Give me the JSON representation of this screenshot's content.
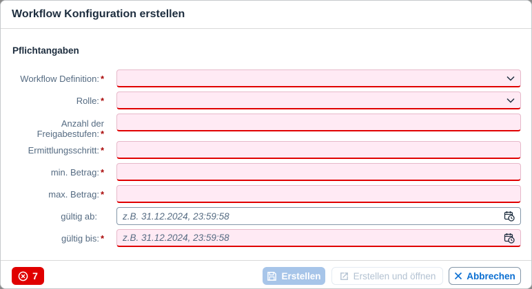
{
  "dialog": {
    "title": "Workflow Konfiguration erstellen"
  },
  "section": {
    "title": "Pflichtangaben"
  },
  "fields": {
    "workflow_definition": {
      "label": "Workflow Definition:",
      "required_mark": "*"
    },
    "rolle": {
      "label": "Rolle:",
      "required_mark": "*"
    },
    "anzahl": {
      "label_line1": "Anzahl der",
      "label_line2": "Freigabestufen:",
      "required_mark": "*"
    },
    "ermittlungsschritt": {
      "label": "Ermittlungsschritt:",
      "required_mark": "*"
    },
    "min_betrag": {
      "label": "min. Betrag:",
      "required_mark": "*"
    },
    "max_betrag": {
      "label": "max. Betrag:",
      "required_mark": "*"
    },
    "gueltig_ab": {
      "label": "gültig ab:",
      "placeholder": "z.B. 31.12.2024, 23:59:58"
    },
    "gueltig_bis": {
      "label": "gültig bis:",
      "required_mark": "*",
      "placeholder": "z.B. 31.12.2024, 23:59:58"
    }
  },
  "footer": {
    "error_count": "7",
    "create_label": "Erstellen",
    "create_open_label": "Erstellen und öffnen",
    "cancel_label": "Abbrechen"
  },
  "colors": {
    "error": "#e00000",
    "primary_disabled": "#a7c5e9",
    "accent": "#0a6ed1",
    "error_field_bg": "#ffeaf4"
  }
}
